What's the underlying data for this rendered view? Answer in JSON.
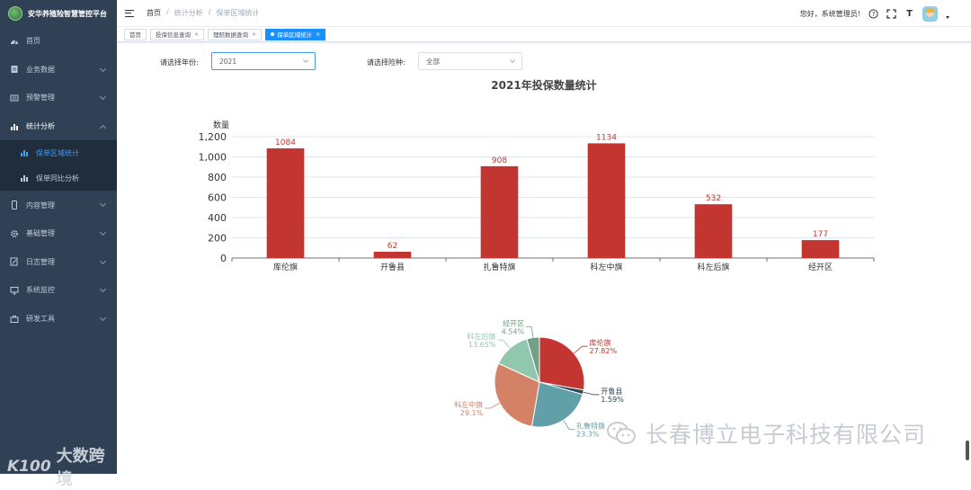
{
  "app": {
    "title": "安华养殖险智慧管控平台",
    "colors": {
      "sidebar_bg": "#304156",
      "accent": "#409eff",
      "bar": "#c23531"
    }
  },
  "sidebar": {
    "items": [
      {
        "label": "首页",
        "icon": "dashboard-icon",
        "has_children": false
      },
      {
        "label": "业务数据",
        "icon": "document-icon",
        "has_children": true
      },
      {
        "label": "预警管理",
        "icon": "list-icon",
        "has_children": true
      },
      {
        "label": "统计分析",
        "icon": "bar-chart-icon",
        "has_children": true,
        "expanded": true,
        "children": [
          {
            "label": "保单区域统计",
            "icon": "bar-chart-icon",
            "active": true
          },
          {
            "label": "保单同比分析",
            "icon": "bar-chart-icon",
            "active": false
          }
        ]
      },
      {
        "label": "内容管理",
        "icon": "mobile-icon",
        "has_children": true
      },
      {
        "label": "基础管理",
        "icon": "gear-icon",
        "has_children": true
      },
      {
        "label": "日志管理",
        "icon": "edit-icon",
        "has_children": true
      },
      {
        "label": "系统监控",
        "icon": "monitor-icon",
        "has_children": true
      },
      {
        "label": "研发工具",
        "icon": "toolbox-icon",
        "has_children": true
      }
    ]
  },
  "header": {
    "breadcrumb": [
      "首页",
      "统计分析",
      "保单区域统计"
    ],
    "greeting": "您好，系统管理员!",
    "font_size_icon_label": "T"
  },
  "tags": [
    {
      "label": "首页",
      "closable": false,
      "active": false
    },
    {
      "label": "投保信息查询",
      "closable": true,
      "active": false
    },
    {
      "label": "理赔数据查询",
      "closable": true,
      "active": false
    },
    {
      "label": "保单区域统计",
      "closable": true,
      "active": true
    }
  ],
  "filters": {
    "year_label": "请选择年份:",
    "year_value": "2021",
    "insurance_label": "请选择险种:",
    "insurance_value": "全部"
  },
  "chart_data": [
    {
      "type": "bar",
      "title": "2021年投保数量统计",
      "ylabel": "数量",
      "xlabel": "",
      "categories": [
        "库伦旗",
        "开鲁县",
        "扎鲁特旗",
        "科左中旗",
        "科左后旗",
        "经开区"
      ],
      "values": [
        1084,
        62,
        908,
        1134,
        532,
        177
      ],
      "ylim": [
        0,
        1200
      ],
      "yticks": [
        "0",
        "200",
        "400",
        "600",
        "800",
        "1,000",
        "1,200"
      ],
      "grid": true,
      "color": "#c23531"
    },
    {
      "type": "pie",
      "slices": [
        {
          "label": "库伦旗",
          "percent": "27.82%",
          "value": 27.82,
          "color": "#c23531"
        },
        {
          "label": "开鲁县",
          "percent": "1.59%",
          "value": 1.59,
          "color": "#2f4554"
        },
        {
          "label": "扎鲁特旗",
          "percent": "23.3%",
          "value": 23.3,
          "color": "#61a0a8"
        },
        {
          "label": "科左中旗",
          "percent": "29.1%",
          "value": 29.1,
          "color": "#d48265"
        },
        {
          "label": "科左后旗",
          "percent": "13.65%",
          "value": 13.65,
          "color": "#91c7ae"
        },
        {
          "label": "经开区",
          "percent": "4.54%",
          "value": 4.54,
          "color": "#749f83"
        }
      ]
    }
  ],
  "watermarks": {
    "left": "大数跨境",
    "left_logo": "K100",
    "right": "长春博立电子科技有限公司"
  }
}
